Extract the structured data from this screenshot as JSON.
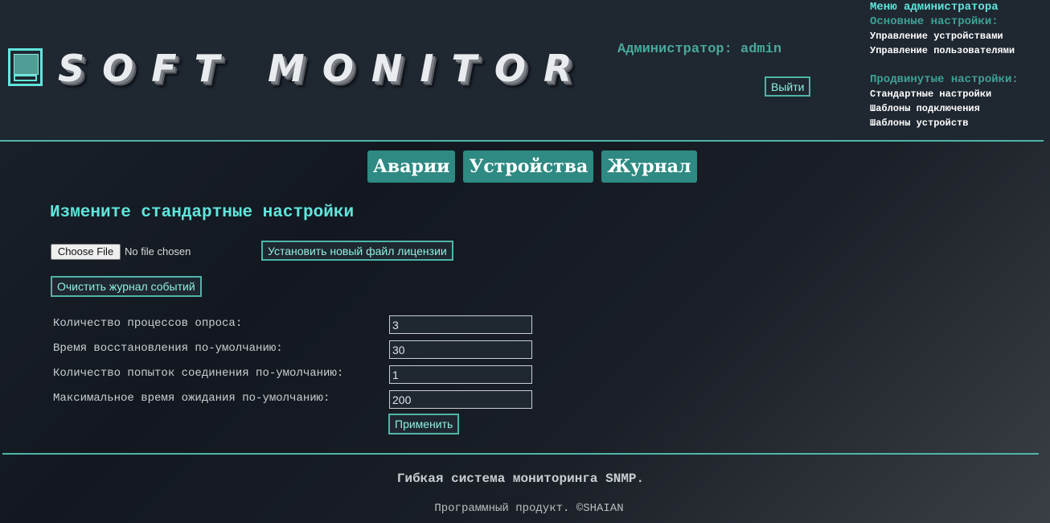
{
  "header": {
    "logo_text": "SOFT MONITOR",
    "admin_label": "Администратор: admin",
    "logout_label": "Выйти"
  },
  "admin_menu": {
    "title": "Меню администратора",
    "basic_section": "Основные настройки:",
    "basic_items": [
      "Управление устройствами",
      "Управление пользователями"
    ],
    "advanced_section": "Продвинутые настройки:",
    "advanced_items": [
      "Стандартные настройки",
      "Шаблоны подключения",
      "Шаблоны устройств"
    ]
  },
  "nav": {
    "tabs": [
      "Аварии",
      "Устройства",
      "Журнал"
    ]
  },
  "main": {
    "title": "Измените стандартные настройки",
    "file_button": "Choose File",
    "file_status": "No file chosen",
    "license_button": "Установить новый файл лицензии",
    "clear_log_button": "Очистить журнал событий",
    "fields": [
      {
        "label": "Количество процессов опроса:",
        "value": "3"
      },
      {
        "label": "Время восстановления по-умолчанию:",
        "value": "30"
      },
      {
        "label": "Количество попыток соединения по-умолчанию:",
        "value": "1"
      },
      {
        "label": "Максимальное время ожидания по-умолчанию:",
        "value": "200"
      }
    ],
    "apply_button": "Применить"
  },
  "footer": {
    "tagline": "Гибкая система мониторинга SNMP.",
    "copyright": "Программный продукт. ©SHAIAN"
  }
}
